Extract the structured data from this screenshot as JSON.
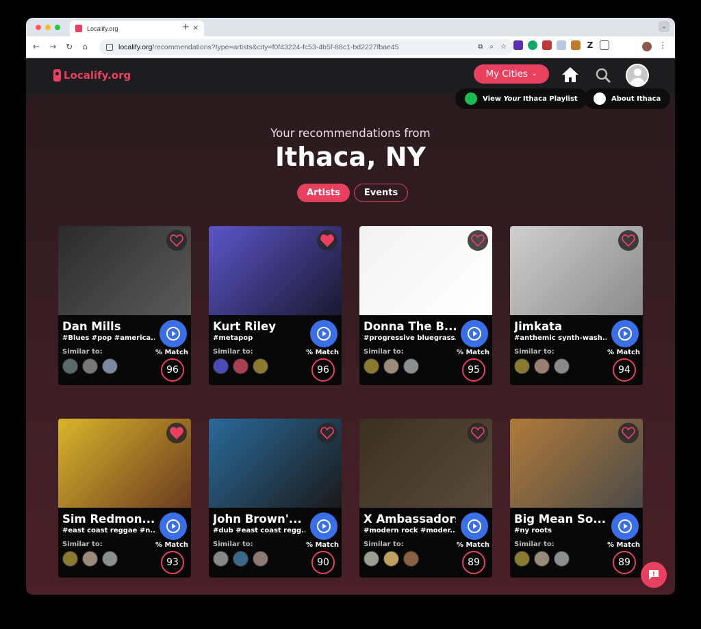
{
  "browser": {
    "tab_title": "Localify.org",
    "url_domain": "localify.org",
    "url_path": "/recommendations?type=artists&city=f0f43224-fc53-4b5f-88c1-bd2227fbae45"
  },
  "header": {
    "logo": "Localify.org",
    "my_cities": "My Cities"
  },
  "top_buttons": {
    "playlist_prefix": "View ",
    "playlist_your": "Your",
    "playlist_suffix": " Ithaca Playlist",
    "about": "About Ithaca"
  },
  "hero": {
    "subtitle": "Your recommendations from",
    "city": "Ithaca, NY"
  },
  "toggle": {
    "artists": "Artists",
    "events": "Events"
  },
  "labels": {
    "similar": "Similar to:",
    "match": "% Match"
  },
  "colors": {
    "accent": "#e8405f",
    "play": "#3b6fe8",
    "header_bg": "#1d1d1f"
  },
  "cards": [
    {
      "name": "Dan Mills",
      "tags": "#Blues #pop #america...",
      "score": "96",
      "liked": false,
      "img": "#2b2b2b",
      "img2": "#5a5a5a",
      "thumbs": [
        "#5a6a6a",
        "#777",
        "#7a8aa0"
      ]
    },
    {
      "name": "Kurt Riley",
      "tags": "#metapop",
      "score": "96",
      "liked": true,
      "img": "#5a55c8",
      "img2": "#1a1830",
      "thumbs": [
        "#4a4ab8",
        "#a84050",
        "#8a7a30"
      ]
    },
    {
      "name": "Donna The B...",
      "tags": "#progressive bluegrass...",
      "score": "95",
      "liked": false,
      "img": "#f2f2f2",
      "img2": "#ffffff",
      "thumbs": [
        "#8a7a30",
        "#9a8a7a",
        "#8a8f90"
      ]
    },
    {
      "name": "Jimkata",
      "tags": "#anthemic synth-wash...",
      "score": "94",
      "liked": false,
      "img": "#cfcfcf",
      "img2": "#8a8a8a",
      "thumbs": [
        "#8a7a30",
        "#9a8070",
        "#8a8a8a"
      ]
    },
    {
      "name": "Sim Redmon...",
      "tags": "#east coast reggae #n...",
      "score": "93",
      "liked": true,
      "img": "#d9b52a",
      "img2": "#6a3a20",
      "thumbs": [
        "#8a7a30",
        "#9a8a7a",
        "#8a8f90"
      ]
    },
    {
      "name": "John Brown'...",
      "tags": "#dub #east coast regg...",
      "score": "90",
      "liked": false,
      "img": "#2a6a9a",
      "img2": "#1a1a1a",
      "thumbs": [
        "#888",
        "#3a6a8a",
        "#8a7a70"
      ]
    },
    {
      "name": "X Ambassadors",
      "tags": "#modern rock #moder...",
      "score": "89",
      "liked": false,
      "img": "#3a3020",
      "img2": "#5a4a3a",
      "thumbs": [
        "#9aa090",
        "#c0a060",
        "#8a6040"
      ]
    },
    {
      "name": "Big Mean So...",
      "tags": "#ny roots",
      "score": "89",
      "liked": false,
      "img": "#b07a3a",
      "img2": "#4a4a48",
      "thumbs": [
        "#8a7a30",
        "#9a8a7a",
        "#8a8f90"
      ]
    }
  ]
}
